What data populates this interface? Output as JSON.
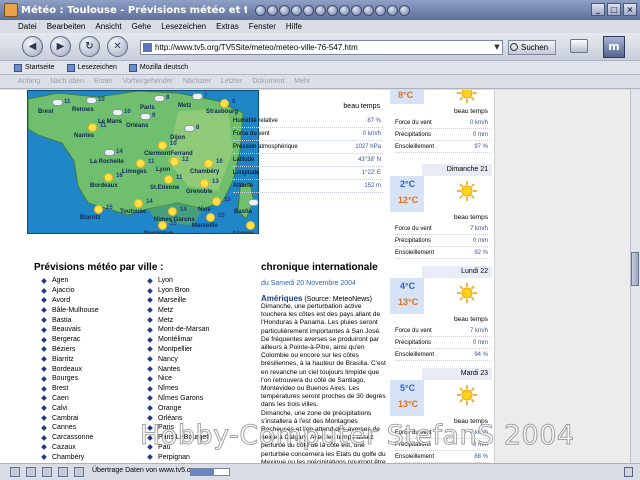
{
  "window": {
    "title": "Météo : Toulouse - Prévisions météo et temps actuel",
    "controls": [
      "_",
      "□",
      "×"
    ]
  },
  "menu": [
    "Datei",
    "Bearbeiten",
    "Ansicht",
    "Gehe",
    "Lesezeichen",
    "Extras",
    "Fenster",
    "Hilfe"
  ],
  "nav": {
    "url": "http://www.tv5.org/TV5Site/meteo/meteo-ville-76-547.htm",
    "search_label": "Suchen",
    "logo": "m"
  },
  "bookmarks": [
    "Startseite",
    "Lesezeichen",
    "Mozilla deutsch"
  ],
  "tabs_toolbar": [
    "Anfang",
    "Nach oben",
    "Erster",
    "Vorhergehender",
    "Nächster",
    "Letzter",
    "Dokument",
    "Mehr"
  ],
  "map": {
    "cities": [
      {
        "name": "Brest",
        "temp": "11",
        "icon": "cloud"
      },
      {
        "name": "Rennes",
        "temp": "10",
        "icon": "cloud"
      },
      {
        "name": "Paris",
        "temp": "8",
        "icon": "cloud"
      },
      {
        "name": "Metz",
        "temp": "7",
        "icon": "cloud"
      },
      {
        "name": "Strasbourg",
        "temp": "8",
        "icon": "sun"
      },
      {
        "name": "Le Mans",
        "temp": "10",
        "icon": "cloud"
      },
      {
        "name": "Orléans",
        "temp": "9",
        "icon": "cloud"
      },
      {
        "name": "Nantes",
        "temp": "11",
        "icon": "sun"
      },
      {
        "name": "Dijon",
        "temp": "8",
        "icon": "cloud"
      },
      {
        "name": "ClermontFerrand",
        "temp": "10",
        "icon": "sun"
      },
      {
        "name": "La Rochelle",
        "temp": "14",
        "icon": "cloud"
      },
      {
        "name": "Limoges",
        "temp": "11",
        "icon": "sun"
      },
      {
        "name": "Lyon",
        "temp": "12",
        "icon": "sun"
      },
      {
        "name": "Chambéry",
        "temp": "10",
        "icon": "sun"
      },
      {
        "name": "Bordeaux",
        "temp": "16",
        "icon": "sun"
      },
      {
        "name": "St.Etienne",
        "temp": "11",
        "icon": "sun"
      },
      {
        "name": "Grenoble",
        "temp": "13",
        "icon": "sun"
      },
      {
        "name": "Biarritz",
        "temp": "15",
        "icon": "sun"
      },
      {
        "name": "Toulouse",
        "temp": "14",
        "icon": "sun"
      },
      {
        "name": "Nimes Garons",
        "temp": "14",
        "icon": "sun"
      },
      {
        "name": "Nice",
        "temp": "15",
        "icon": "sun"
      },
      {
        "name": "Bastia",
        "temp": "6",
        "icon": "cloud"
      },
      {
        "name": "Marseille",
        "temp": "15",
        "icon": "sun"
      },
      {
        "name": "Perpignan",
        "temp": "15",
        "icon": "sun"
      },
      {
        "name": "Ajaccio",
        "temp": "14",
        "icon": "sun"
      }
    ]
  },
  "list": {
    "title": "Prévisions météo par ville :",
    "col1": [
      "Agen",
      "Ajaccio",
      "Avord",
      "Bâle-Mulhouse",
      "Bastia",
      "Beauvais",
      "Bergerac",
      "Béziers",
      "Biarritz",
      "Bordeaux",
      "Bourges",
      "Brest",
      "Caen",
      "Calvi",
      "Cambrai",
      "Cannes",
      "Carcassonne",
      "Cazaux",
      "Chambéry",
      "Chateauroux",
      "Cherbourg"
    ],
    "col2": [
      "Lyon",
      "Lyon Bron",
      "Marseille",
      "Metz",
      "Metz",
      "Mont-de-Marsan",
      "Montélimar",
      "Montpellier",
      "Nancy",
      "Nantes",
      "Nice",
      "Nîmes",
      "Nîmes Garons",
      "Orange",
      "Orléans",
      "Paris",
      "Paris LeBourget",
      "Pau",
      "Perpignan",
      "Poitiers",
      "Porquerolles"
    ]
  },
  "detail": {
    "sky": "beau temps",
    "rows": [
      {
        "label": "Humidité relative",
        "value": "87 %"
      },
      {
        "label": "Force du vent",
        "value": "0 km/h"
      },
      {
        "label": "Pression atmosphérique",
        "value": "1027 hPa"
      },
      {
        "label": "Latitude",
        "value": "43°38' N"
      },
      {
        "label": "Longitude",
        "value": "1°22' E"
      },
      {
        "label": "Altitude",
        "value": "152 m"
      }
    ]
  },
  "article": {
    "title": "chronique internationale",
    "date": "du Samedi 20 Novembre 2004",
    "lead_word": "Amériques",
    "source": "(Source: MeteoNews)",
    "body": [
      "Dimanche, une perturbation active touchera les côtes est des pays allant de l'Honduras à Panama. Les pluies seront particulièrement importantes à San José. De fréquentes averses se produiront par ailleurs à Pointe-à-Pitre, ainsi qu'en Colombie ou encore sur les côtes brésiliennes, à la hauteur de Brasilia. C'est en revanche un ciel toujours limpide que l'on retrouvera du côté de Santiago, Montevideo ou Buenos Aires. Les températures seront proches de 30 degrés dans les trois villes.",
      "Dimanche, une zone de précipitations s'installera à l'est des Montagnes Rocheuses et l'on attend des averses de neige à Calgary. Avec les temps assez perturbé du côté de la côte est, une perturbée concernera les Etats du golfe du Mexique ou les précipitations pourront être importantes, une"
    ]
  },
  "forecast": [
    {
      "day": "",
      "tmin": "",
      "tmax": "8°C",
      "sky": "beau temps",
      "vent": "0 km/h",
      "precip": "0 mm",
      "sun": "97 %"
    },
    {
      "day": "Dimanche 21",
      "tmin": "2°C",
      "tmax": "12°C",
      "sky": "beau temps",
      "vent": "7 km/h",
      "precip": "0 mm",
      "sun": "92 %"
    },
    {
      "day": "Lundi 22",
      "tmin": "4°C",
      "tmax": "13°C",
      "sky": "beau temps",
      "vent": "7 km/h",
      "precip": "0 mm",
      "sun": "94 %"
    },
    {
      "day": "Mardi 23",
      "tmin": "5°C",
      "tmax": "13°C",
      "sky": "beau temps",
      "vent": "4 km/h",
      "precip": "0 mm",
      "sun": "88 %"
    }
  ],
  "forecast_labels": {
    "vent": "Force du vent",
    "precip": "Précipitations",
    "sun": "Ensoleillement"
  },
  "status": {
    "text": "Übertrage Daten von www.tv5.org...",
    "progress": 0.6
  },
  "watermark": "Hobby-Computer StefanS 2004"
}
